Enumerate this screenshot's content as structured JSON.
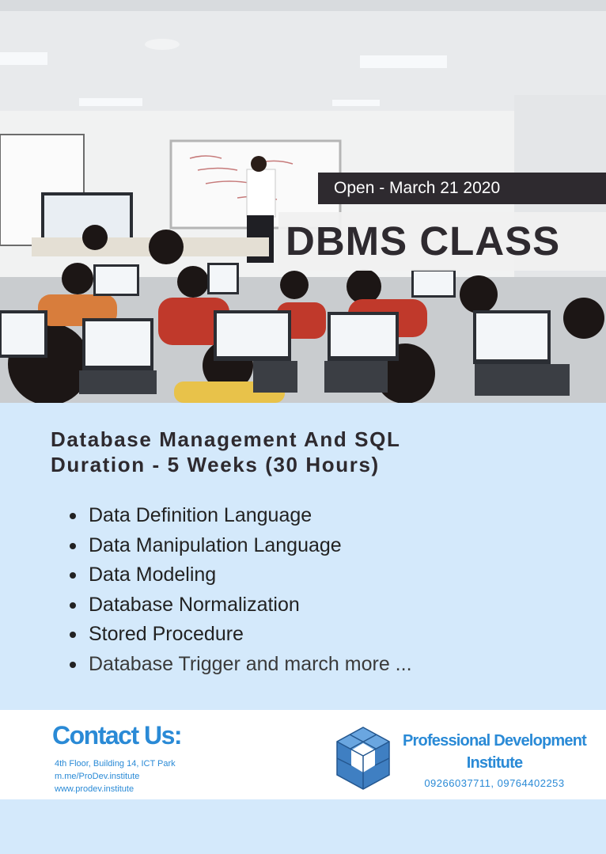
{
  "banner": {
    "open_date": "Open - March 21 2020",
    "title": "DBMS CLASS"
  },
  "course": {
    "line1": "Database Management And SQL",
    "line2": "Duration - 5 Weeks (30 Hours)",
    "topics": [
      "Data Definition Language",
      "Data Manipulation Language",
      "Data Modeling",
      "Database Normalization",
      "Stored Procedure",
      "Database Trigger and march more ..."
    ]
  },
  "contact": {
    "heading": "Contact Us:",
    "address": "4th Floor, Building 14, ICT Park",
    "messenger": "m.me/ProDev.institute",
    "website": "www.prodev.institute"
  },
  "organization": {
    "name_line1": "Professional Development",
    "name_line2": "Institute",
    "phones": "09266037711, 09764402253"
  },
  "colors": {
    "accent_blue": "#2a8ad6",
    "light_blue_bg": "#d4e9fb",
    "dark_banner": "#2e2a2f"
  }
}
